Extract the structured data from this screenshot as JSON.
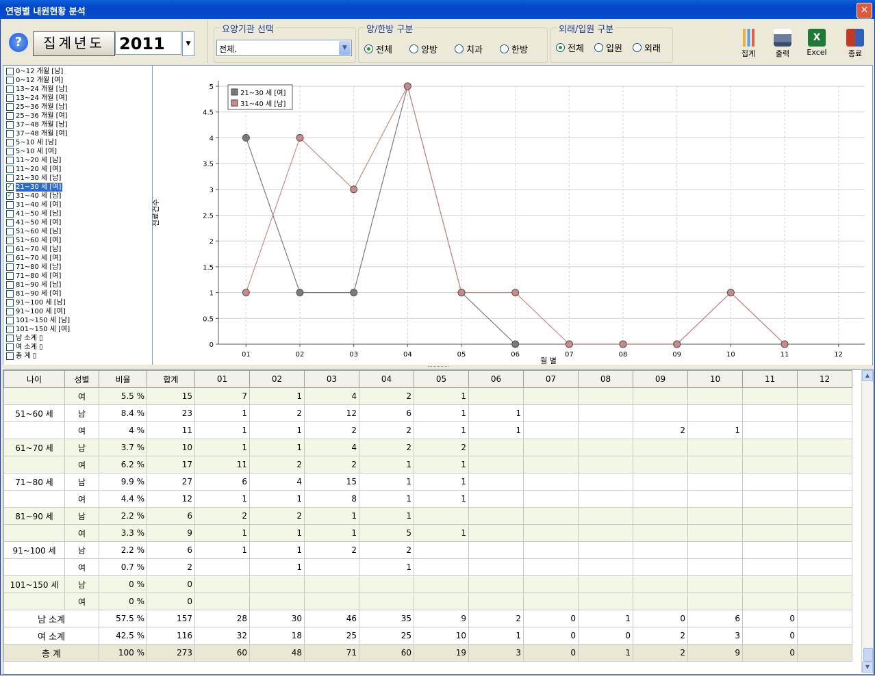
{
  "window": {
    "title": "연령별 내원현황 분석",
    "close": "✕"
  },
  "toolbar": {
    "help": "?",
    "year_button": "집계년도",
    "year_value": "2011",
    "institution_label": "요양기관 선택",
    "institution_value": "전체.",
    "type_label": "양/한방 구분",
    "type_options": [
      "전체",
      "양방",
      "치과",
      "한방"
    ],
    "type_selected": "전체",
    "visit_label": "외래/입원 구분",
    "visit_options": [
      "전체",
      "입원",
      "외래"
    ],
    "visit_selected": "전체",
    "tools": [
      {
        "label": "집계",
        "icon": "bar-chart-icon"
      },
      {
        "label": "출력",
        "icon": "printer-icon"
      },
      {
        "label": "Excel",
        "icon": "excel-icon"
      },
      {
        "label": "종료",
        "icon": "exit-icon"
      }
    ]
  },
  "age_groups": [
    {
      "label": "0~12 개월 [남]",
      "checked": false
    },
    {
      "label": "0~12 개월 [여]",
      "checked": false
    },
    {
      "label": "13~24 개월 [남]",
      "checked": false
    },
    {
      "label": "13~24 개월 [여]",
      "checked": false
    },
    {
      "label": "25~36 개월 [남]",
      "checked": false
    },
    {
      "label": "25~36 개월 [여]",
      "checked": false
    },
    {
      "label": "37~48 개월 [남]",
      "checked": false
    },
    {
      "label": "37~48 개월 [여]",
      "checked": false
    },
    {
      "label": "5~10 세 [남]",
      "checked": false
    },
    {
      "label": "5~10 세 [여]",
      "checked": false
    },
    {
      "label": "11~20 세 [남]",
      "checked": false
    },
    {
      "label": "11~20 세 [여]",
      "checked": false
    },
    {
      "label": "21~30 세 [남]",
      "checked": false
    },
    {
      "label": "21~30 세 [여]",
      "checked": true,
      "selected": true
    },
    {
      "label": "31~40 세 [남]",
      "checked": true
    },
    {
      "label": "31~40 세 [여]",
      "checked": false
    },
    {
      "label": "41~50 세 [남]",
      "checked": false
    },
    {
      "label": "41~50 세 [여]",
      "checked": false
    },
    {
      "label": "51~60 세 [남]",
      "checked": false
    },
    {
      "label": "51~60 세 [여]",
      "checked": false
    },
    {
      "label": "61~70 세 [남]",
      "checked": false
    },
    {
      "label": "61~70 세 [여]",
      "checked": false
    },
    {
      "label": "71~80 세 [남]",
      "checked": false
    },
    {
      "label": "71~80 세 [여]",
      "checked": false
    },
    {
      "label": "81~90 세 [남]",
      "checked": false
    },
    {
      "label": "81~90 세 [여]",
      "checked": false
    },
    {
      "label": "91~100 세 [남]",
      "checked": false
    },
    {
      "label": "91~100 세 [여]",
      "checked": false
    },
    {
      "label": "101~150 세 [남]",
      "checked": false
    },
    {
      "label": "101~150 세 [여]",
      "checked": false
    },
    {
      "label": "남 소계 ▯",
      "checked": false
    },
    {
      "label": "여 소계 ▯",
      "checked": false
    },
    {
      "label": "총  계 ▯",
      "checked": false
    }
  ],
  "chart_data": {
    "type": "line",
    "xlabel": "월 별",
    "ylabel": "진료건수",
    "categories": [
      "01",
      "02",
      "03",
      "04",
      "05",
      "06",
      "07",
      "08",
      "09",
      "10",
      "11",
      "12"
    ],
    "ylim": [
      0,
      5
    ],
    "yticks": [
      "0",
      "0.5",
      "1",
      "1.5",
      "2",
      "2.5",
      "3",
      "3.5",
      "4",
      "4.5",
      "5"
    ],
    "grid": true,
    "legend_position": "top-left",
    "series": [
      {
        "name": "21~30 세 [여]",
        "color": "#7a7a7a",
        "values": [
          4,
          1,
          1,
          5,
          1,
          0,
          0,
          0,
          0,
          1,
          0,
          null
        ]
      },
      {
        "name": "31~40 세 [남]",
        "color": "#c78a8a",
        "values": [
          1,
          4,
          3,
          5,
          1,
          1,
          0,
          0,
          0,
          1,
          0,
          null
        ]
      }
    ]
  },
  "table": {
    "headers": [
      "나이",
      "성별",
      "비율",
      "합계",
      "01",
      "02",
      "03",
      "04",
      "05",
      "06",
      "07",
      "08",
      "09",
      "10",
      "11",
      "12"
    ],
    "rows": [
      {
        "age": "",
        "sex": "여",
        "ratio": "5.5 %",
        "total": "15",
        "m": [
          "7",
          "1",
          "4",
          "2",
          "1",
          "",
          "",
          "",
          "",
          "",
          "",
          ""
        ]
      },
      {
        "age": "51~60 세",
        "sex": "남",
        "ratio": "8.4 %",
        "total": "23",
        "m": [
          "1",
          "2",
          "12",
          "6",
          "1",
          "1",
          "",
          "",
          "",
          "",
          "",
          ""
        ]
      },
      {
        "age": "",
        "sex": "여",
        "ratio": "4 %",
        "total": "11",
        "m": [
          "1",
          "1",
          "2",
          "2",
          "1",
          "1",
          "",
          "",
          "2",
          "1",
          "",
          ""
        ]
      },
      {
        "age": "61~70 세",
        "sex": "남",
        "ratio": "3.7 %",
        "total": "10",
        "m": [
          "1",
          "1",
          "4",
          "2",
          "2",
          "",
          "",
          "",
          "",
          "",
          "",
          ""
        ]
      },
      {
        "age": "",
        "sex": "여",
        "ratio": "6.2 %",
        "total": "17",
        "m": [
          "11",
          "2",
          "2",
          "1",
          "1",
          "",
          "",
          "",
          "",
          "",
          "",
          ""
        ]
      },
      {
        "age": "71~80 세",
        "sex": "남",
        "ratio": "9.9 %",
        "total": "27",
        "m": [
          "6",
          "4",
          "15",
          "1",
          "1",
          "",
          "",
          "",
          "",
          "",
          "",
          ""
        ]
      },
      {
        "age": "",
        "sex": "여",
        "ratio": "4.4 %",
        "total": "12",
        "m": [
          "1",
          "1",
          "8",
          "1",
          "1",
          "",
          "",
          "",
          "",
          "",
          "",
          ""
        ]
      },
      {
        "age": "81~90 세",
        "sex": "남",
        "ratio": "2.2 %",
        "total": "6",
        "m": [
          "2",
          "2",
          "1",
          "1",
          "",
          "",
          "",
          "",
          "",
          "",
          "",
          ""
        ]
      },
      {
        "age": "",
        "sex": "여",
        "ratio": "3.3 %",
        "total": "9",
        "m": [
          "1",
          "1",
          "1",
          "5",
          "1",
          "",
          "",
          "",
          "",
          "",
          "",
          ""
        ]
      },
      {
        "age": "91~100 세",
        "sex": "남",
        "ratio": "2.2 %",
        "total": "6",
        "m": [
          "1",
          "1",
          "2",
          "2",
          "",
          "",
          "",
          "",
          "",
          "",
          "",
          ""
        ]
      },
      {
        "age": "",
        "sex": "여",
        "ratio": "0.7 %",
        "total": "2",
        "m": [
          "",
          "1",
          "",
          "1",
          "",
          "",
          "",
          "",
          "",
          "",
          "",
          ""
        ]
      },
      {
        "age": "101~150 세",
        "sex": "남",
        "ratio": "0 %",
        "total": "0",
        "m": [
          "",
          "",
          "",
          "",
          "",
          "",
          "",
          "",
          "",
          "",
          "",
          ""
        ]
      },
      {
        "age": "",
        "sex": "여",
        "ratio": "0 %",
        "total": "0",
        "m": [
          "",
          "",
          "",
          "",
          "",
          "",
          "",
          "",
          "",
          "",
          "",
          ""
        ]
      }
    ],
    "subtotals": [
      {
        "label": "남 소계",
        "ratio": "57.5 %",
        "total": "157",
        "m": [
          "28",
          "30",
          "46",
          "35",
          "9",
          "2",
          "0",
          "1",
          "0",
          "6",
          "0",
          ""
        ]
      },
      {
        "label": "여 소계",
        "ratio": "42.5 %",
        "total": "116",
        "m": [
          "32",
          "18",
          "25",
          "25",
          "10",
          "1",
          "0",
          "0",
          "2",
          "3",
          "0",
          ""
        ]
      },
      {
        "label": "총  계",
        "ratio": "100 %",
        "total": "273",
        "m": [
          "60",
          "48",
          "71",
          "60",
          "19",
          "3",
          "0",
          "1",
          "2",
          "9",
          "0",
          ""
        ]
      }
    ]
  }
}
